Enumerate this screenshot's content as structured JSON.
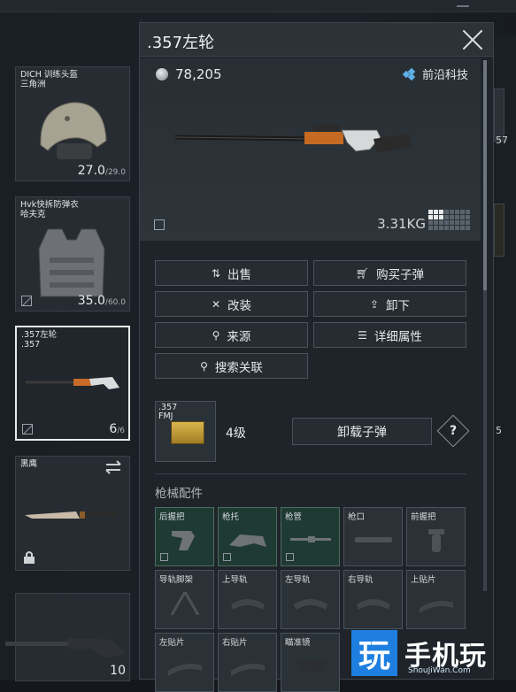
{
  "left_slots": [
    {
      "name": "DICH 训练头盔\n三角洲",
      "durability": "27.0",
      "max": "/29.0"
    },
    {
      "name": "Hvk快拆防弹衣\n哈夫克",
      "durability": "35.0",
      "max": "/60.0"
    },
    {
      "name": ".357左轮\n.357",
      "durability": "6",
      "max": "/6"
    },
    {
      "name": "黑鹰",
      "durability": "",
      "max": ""
    },
    {
      "name": "",
      "durability": "10",
      "max": ""
    }
  ],
  "panel": {
    "title": ".357左轮",
    "price": "78,205",
    "brand": "前沿科技",
    "weight": "3.31KG"
  },
  "actions": {
    "sell": "出售",
    "buy_ammo": "购买子弹",
    "modify": "改装",
    "unequip": "卸下",
    "source": "来源",
    "details": "详细属性",
    "search_related": "搜索关联"
  },
  "ammo": {
    "label": ".357\nFMJ",
    "grade": "4级",
    "unload": "卸载子弹",
    "help": "?"
  },
  "attachments": {
    "title": "枪械配件",
    "slots": [
      "后握把",
      "枪托",
      "枪管",
      "枪口",
      "前握把",
      "导轨脚架",
      "上导轨",
      "左导轨",
      "右导轨",
      "上贴片",
      "左贴片",
      "右贴片",
      "瞄准镜"
    ]
  },
  "right_strip": {
    "numbers": [
      "57",
      "5"
    ]
  },
  "watermark": {
    "logo": "玩",
    "text": "手机玩",
    "sub": "ShouJiWan.Com"
  },
  "colors": {
    "accent_blue": "#5fb0e8",
    "attachment_filled": "#1f3a33",
    "watermark_blue": "#1e7fe0"
  }
}
